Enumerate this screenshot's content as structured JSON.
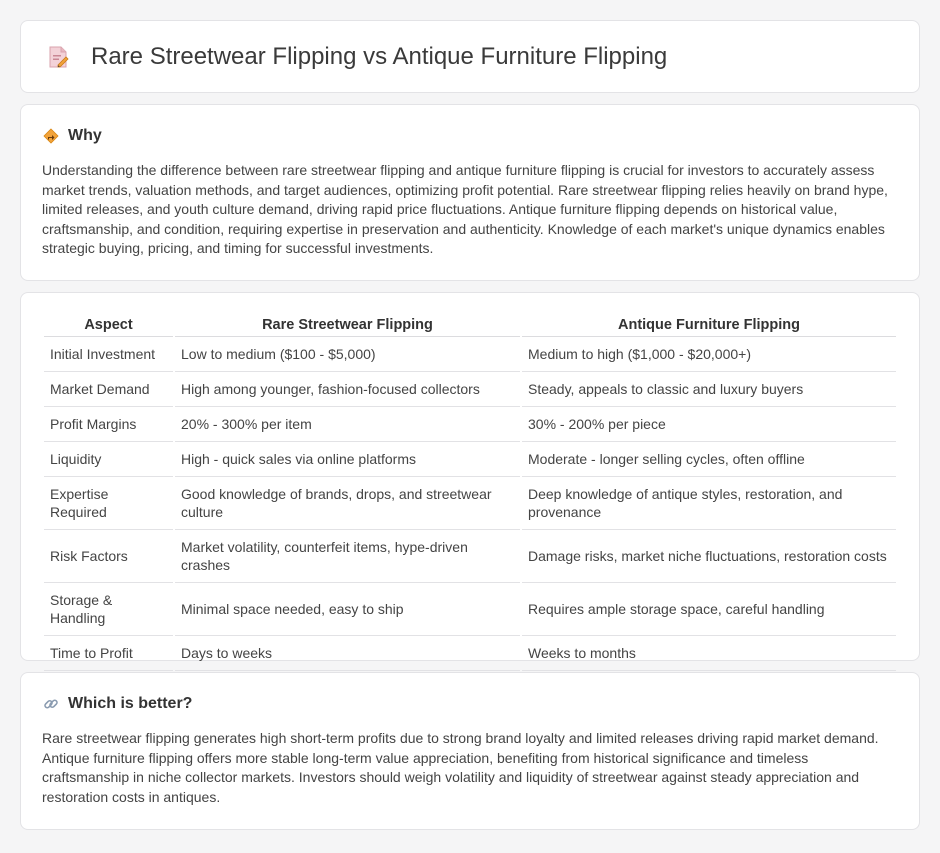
{
  "header": {
    "title": "Rare Streetwear Flipping vs Antique Furniture Flipping",
    "icon": "document-pencil-icon"
  },
  "why": {
    "title": "Why",
    "icon": "diamond-sign-icon",
    "text": "Understanding the difference between rare streetwear flipping and antique furniture flipping is crucial for investors to accurately assess market trends, valuation methods, and target audiences, optimizing profit potential. Rare streetwear flipping relies heavily on brand hype, limited releases, and youth culture demand, driving rapid price fluctuations. Antique furniture flipping depends on historical value, craftsmanship, and condition, requiring expertise in preservation and authenticity. Knowledge of each market's unique dynamics enables strategic buying, pricing, and timing for successful investments."
  },
  "table": {
    "headers": [
      "Aspect",
      "Rare Streetwear Flipping",
      "Antique Furniture Flipping"
    ],
    "rows": [
      [
        "Initial Investment",
        "Low to medium ($100 - $5,000)",
        "Medium to high ($1,000 - $20,000+)"
      ],
      [
        "Market Demand",
        "High among younger, fashion-focused collectors",
        "Steady, appeals to classic and luxury buyers"
      ],
      [
        "Profit Margins",
        "20% - 300% per item",
        "30% - 200% per piece"
      ],
      [
        "Liquidity",
        "High - quick sales via online platforms",
        "Moderate - longer selling cycles, often offline"
      ],
      [
        "Expertise Required",
        "Good knowledge of brands, drops, and streetwear culture",
        "Deep knowledge of antique styles, restoration, and provenance"
      ],
      [
        "Risk Factors",
        "Market volatility, counterfeit items, hype-driven crashes",
        "Damage risks, market niche fluctuations, restoration costs"
      ],
      [
        "Storage & Handling",
        "Minimal space needed, easy to ship",
        "Requires ample storage space, careful handling"
      ],
      [
        "Time to Profit",
        "Days to weeks",
        "Weeks to months"
      ]
    ]
  },
  "better": {
    "title": "Which is better?",
    "icon": "link-icon",
    "text": "Rare streetwear flipping generates high short-term profits due to strong brand loyalty and limited releases driving rapid market demand. Antique furniture flipping offers more stable long-term value appreciation, benefiting from historical significance and timeless craftsmanship in niche collector markets. Investors should weigh volatility and liquidity of streetwear against steady appreciation and restoration costs in antiques."
  },
  "colors": {
    "background": "#f5f5f6",
    "card": "#ffffff",
    "border": "#e3e3e6",
    "accent_orange": "#f2a33a",
    "accent_pink": "#e07a8c"
  }
}
